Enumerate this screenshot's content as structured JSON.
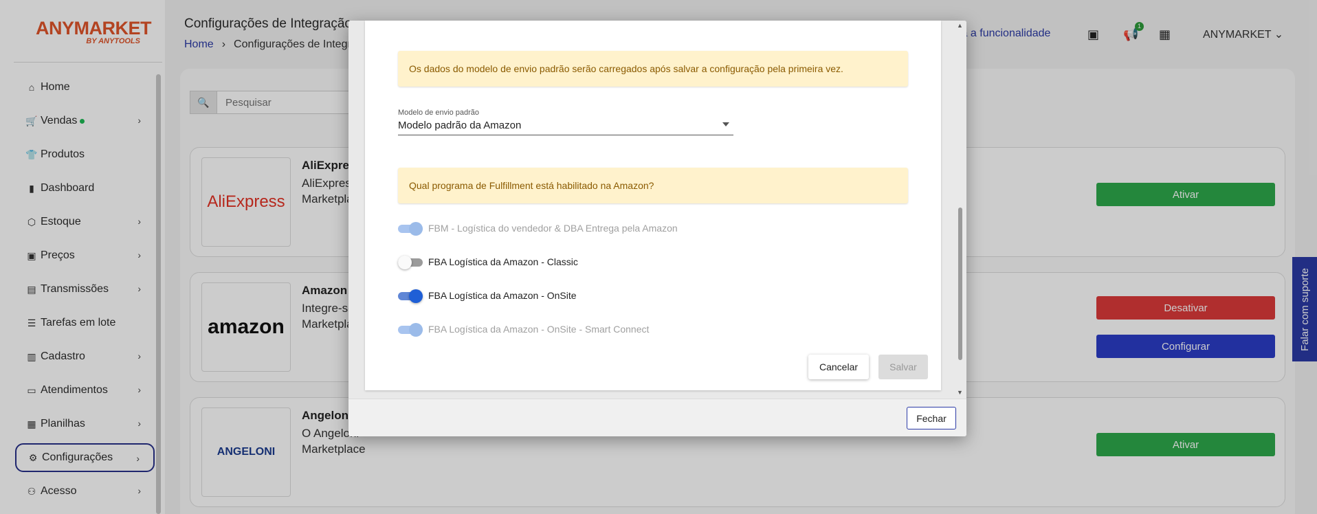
{
  "sidebar": {
    "logo_text": "ANYMARKET",
    "logo_sub": "BY ANYTOOLS",
    "items": [
      {
        "label": "Home",
        "icon": "home-icon",
        "chevron": false
      },
      {
        "label": "Vendas",
        "icon": "cart-icon",
        "chevron": true
      },
      {
        "label": "Produtos",
        "icon": "shirt-icon",
        "chevron": false
      },
      {
        "label": "Dashboard",
        "icon": "bar-chart-icon",
        "chevron": false
      },
      {
        "label": "Estoque",
        "icon": "box-icon",
        "chevron": true
      },
      {
        "label": "Preços",
        "icon": "money-icon",
        "chevron": true
      },
      {
        "label": "Transmissões",
        "icon": "store-icon",
        "chevron": true
      },
      {
        "label": "Tarefas em lote",
        "icon": "list-icon",
        "chevron": false
      },
      {
        "label": "Cadastro",
        "icon": "clipboard-icon",
        "chevron": true
      },
      {
        "label": "Atendimentos",
        "icon": "chat-icon",
        "chevron": true
      },
      {
        "label": "Planilhas",
        "icon": "spreadsheet-icon",
        "chevron": true
      },
      {
        "label": "Configurações",
        "icon": "gear-icon",
        "chevron": true
      },
      {
        "label": "Acesso",
        "icon": "users-icon",
        "chevron": true
      }
    ]
  },
  "header": {
    "title": "Configurações de Integração",
    "breadcrumb_home": "Home",
    "breadcrumb_current": "Configurações de Integração",
    "feature_link": "la a funcionalidade",
    "notification_count": "1",
    "user": "ANYMARKET"
  },
  "search": {
    "placeholder": "Pesquisar"
  },
  "cards": [
    {
      "title": "AliExpress",
      "desc1": "AliExpress",
      "desc2": "Marketplace",
      "logo": "AliExpress",
      "buttons": [
        "Ativar"
      ]
    },
    {
      "title": "Amazon",
      "desc1": "Integre-se",
      "desc2": "Marketplace",
      "logo": "amazon",
      "buttons": [
        "Desativar",
        "Configurar"
      ]
    },
    {
      "title": "Angeloni",
      "desc1": "O Angeloni",
      "desc2": "Marketplace",
      "logo": "ANGELONI",
      "buttons": [
        "Ativar"
      ]
    }
  ],
  "support_tab": "Falar com suporte",
  "modal": {
    "info_alert": "Os dados do modelo de envio padrão serão carregados após salvar a configuração pela primeira vez.",
    "shipping_model_label": "Modelo de envio padrão",
    "shipping_model_value": "Modelo padrão da Amazon",
    "fulfillment_question": "Qual programa de Fulfillment está habilitado na Amazon?",
    "toggles": [
      {
        "label": "FBM - Logística do vendedor & DBA Entrega pela Amazon",
        "state": "on",
        "disabled": true
      },
      {
        "label": "FBA Logística da Amazon - Classic",
        "state": "off",
        "disabled": false
      },
      {
        "label": "FBA Logística da Amazon - OnSite",
        "state": "on",
        "disabled": false
      },
      {
        "label": "FBA Logística da Amazon - OnSite - Smart Connect",
        "state": "on",
        "disabled": true
      }
    ],
    "cancel_label": "Cancelar",
    "save_label": "Salvar",
    "close_label": "Fechar"
  },
  "colors": {
    "brand_orange": "#e0542a",
    "primary_blue": "#2b3aa6",
    "success_green": "#2ea94b",
    "danger_red": "#dc3a3a",
    "toggle_on": "#1f5fd6",
    "alert_bg": "#fff2cc"
  }
}
